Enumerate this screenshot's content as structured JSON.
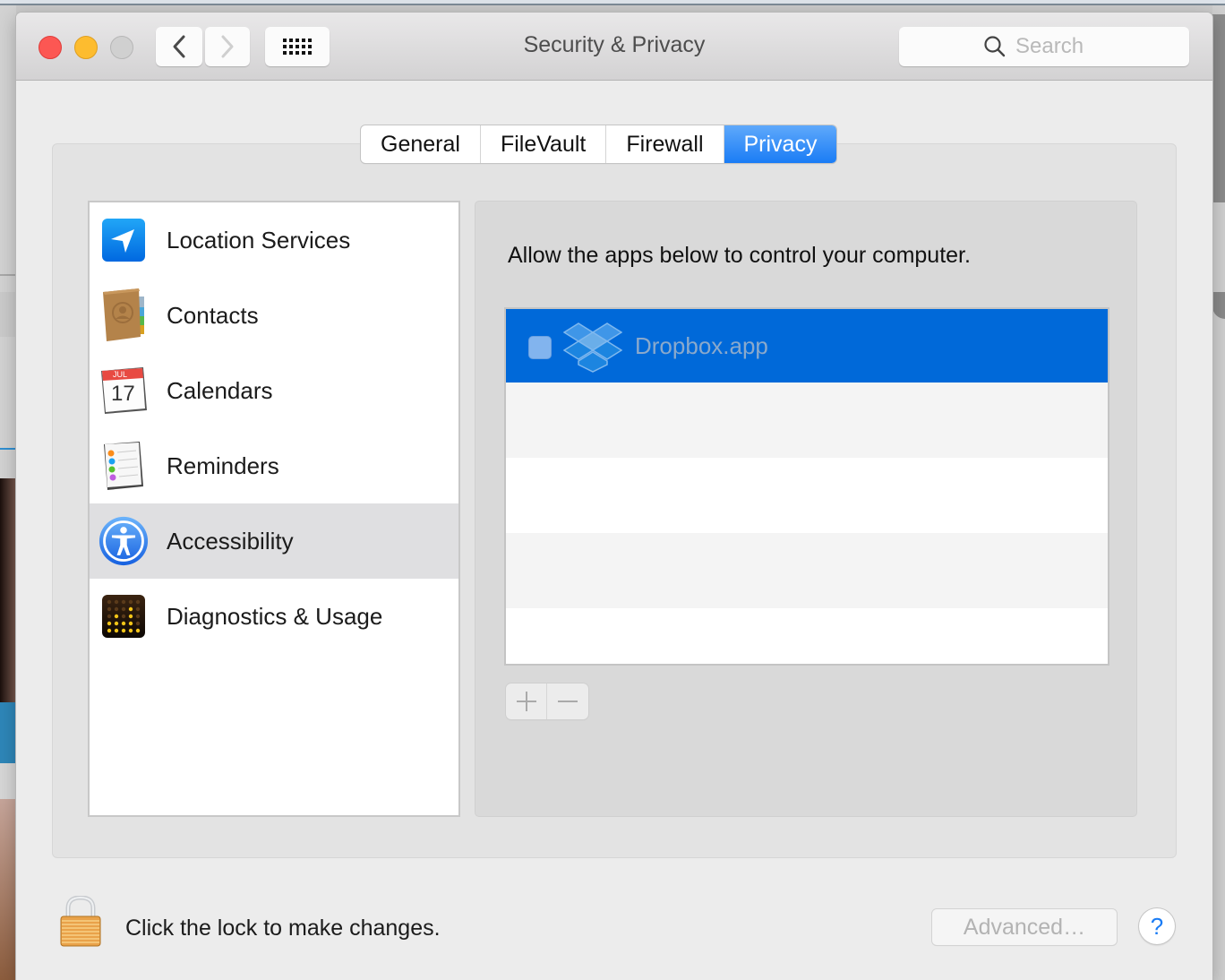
{
  "window": {
    "title": "Security & Privacy"
  },
  "toolbar": {
    "back_icon": "chevron-left-icon",
    "forward_icon": "chevron-right-icon",
    "show_all_icon": "grid-icon",
    "search_placeholder": "Search"
  },
  "tabs": [
    {
      "label": "General",
      "active": false
    },
    {
      "label": "FileVault",
      "active": false
    },
    {
      "label": "Firewall",
      "active": false
    },
    {
      "label": "Privacy",
      "active": true
    }
  ],
  "sidebar": {
    "items": [
      {
        "label": "Location Services",
        "icon": "location-arrow-icon",
        "selected": false
      },
      {
        "label": "Contacts",
        "icon": "contacts-book-icon",
        "selected": false
      },
      {
        "label": "Calendars",
        "icon": "calendar-icon",
        "selected": false,
        "icon_month": "JUL",
        "icon_day": "17"
      },
      {
        "label": "Reminders",
        "icon": "reminders-list-icon",
        "selected": false
      },
      {
        "label": "Accessibility",
        "icon": "accessibility-icon",
        "selected": true
      },
      {
        "label": "Diagnostics & Usage",
        "icon": "diagnostics-icon",
        "selected": false
      }
    ]
  },
  "detail": {
    "heading": "Allow the apps below to control your computer.",
    "apps": [
      {
        "name": "Dropbox.app",
        "icon": "dropbox-icon",
        "checked": false,
        "selected": true
      }
    ],
    "add_label": "+",
    "remove_label": "−"
  },
  "footer": {
    "lock_text": "Click the lock to make changes.",
    "lock_icon": "padlock-icon",
    "advanced_label": "Advanced…",
    "help_label": "?"
  },
  "colors": {
    "accent": "#1a7cf5",
    "selection": "#0069d9",
    "close": "#fc5753",
    "minimize": "#fdbc2f"
  }
}
